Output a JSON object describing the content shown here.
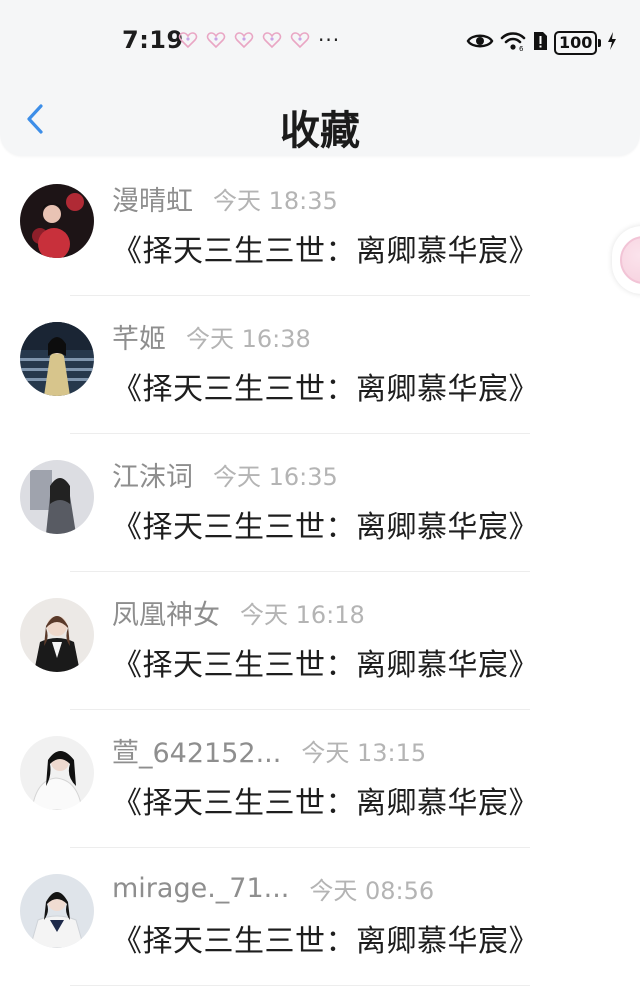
{
  "status_bar": {
    "time": "7:19",
    "more": "···",
    "battery": "100",
    "notification_icons": [
      "heart-icon",
      "heart-icon",
      "heart-icon",
      "heart-icon",
      "heart-icon"
    ]
  },
  "header": {
    "title": "收藏",
    "back_icon": "chevron-left-icon"
  },
  "colors": {
    "accent": "#3d8ee8",
    "name_gray": "#8e8e8e",
    "time_gray": "#b4b4b4",
    "header_bg": "#f5f6f7"
  },
  "favorites": [
    {
      "name": "漫晴虹",
      "time": "今天 18:35",
      "text": "《择天三生三世：离卿慕华宸》"
    },
    {
      "name": "芊姬",
      "time": "今天 16:38",
      "text": "《择天三生三世：离卿慕华宸》"
    },
    {
      "name": "江沫词",
      "time": "今天 16:35",
      "text": "《择天三生三世：离卿慕华宸》"
    },
    {
      "name": "凤凰神女",
      "time": "今天 16:18",
      "text": "《择天三生三世：离卿慕华宸》"
    },
    {
      "name": "萱_642152...",
      "time": "今天 13:15",
      "text": "《择天三生三世：离卿慕华宸》"
    },
    {
      "name": "mirage._71...",
      "time": "今天 08:56",
      "text": "《择天三生三世：离卿慕华宸》"
    }
  ]
}
